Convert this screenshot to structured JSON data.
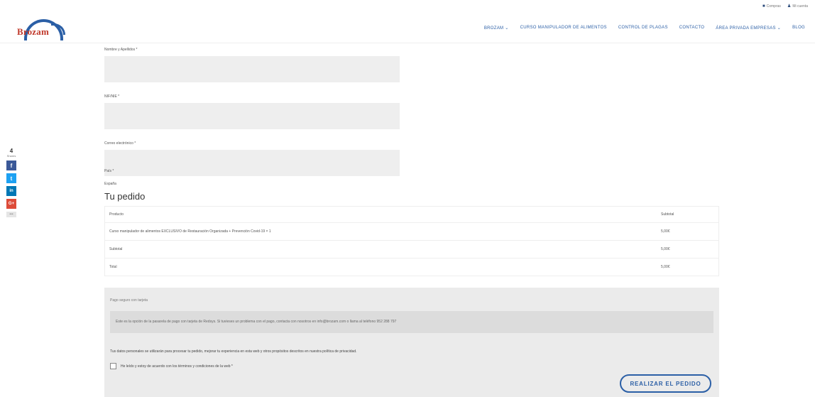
{
  "colors": {
    "brand_blue": "#2b5fa6",
    "brand_red": "#c0392b",
    "facebook": "#3b5998",
    "twitter": "#1da1f2",
    "linkedin": "#0077b5",
    "googleplus": "#dd4b39"
  },
  "topbar": {
    "cart_label": "Compras",
    "account_label": "Mi cuenta",
    "cart_icon": "cart-icon",
    "account_icon": "user-icon"
  },
  "logo": {
    "text": "Brozam"
  },
  "nav": {
    "items": [
      "BROZAM ⌄",
      "CURSO MANIPULADOR DE ALIMENTOS",
      "CONTROL DE PLAGAS",
      "CONTACTO",
      "ÁREA PRIVADA EMPRESAS ⌄",
      "BLOG"
    ]
  },
  "social": {
    "count": "4",
    "count_label": "Shares",
    "facebook_icon": "f",
    "twitter_icon": "t",
    "linkedin_icon": "in",
    "googleplus_icon": "G+",
    "more": "•••"
  },
  "form": {
    "name_label": "Nombre y Apellidos *",
    "nif_label": "NIF/NIE *",
    "email_label": "Correo electrónico *",
    "country_label": "País *",
    "country_value": "España"
  },
  "order": {
    "title": "Tu pedido",
    "headers": [
      "Producto",
      "Subtotal"
    ],
    "rows": [
      {
        "label": "Curso manipulador de alimentos EXCLUSIVO de Restauración Organizada + Prevención Covid-19 × 1",
        "value": "5,00€"
      },
      {
        "label": "Subtotal",
        "value": "5,00€"
      },
      {
        "label": "Total",
        "value": "5,00€"
      }
    ]
  },
  "payment": {
    "method": "Pago seguro con tarjeta",
    "info": "Este es la opción de la pasarela de pago con tarjeta de Redsys. Si tuvieses un problema con el pago, contacta con nosotros en info@brozam.com o llama al teléfono 952 288 797",
    "privacy": "Tus datos personales se utilizarán para procesar tu pedido, mejorar tu experiencia en esta web y otros propósitos descritos en nuestra política de privacidad.",
    "privacy_link": "política de privacidad",
    "terms": "He leído y estoy de acuerdo con los términos y condiciones de la web *",
    "submit": "REALIZAR EL PEDIDO"
  }
}
